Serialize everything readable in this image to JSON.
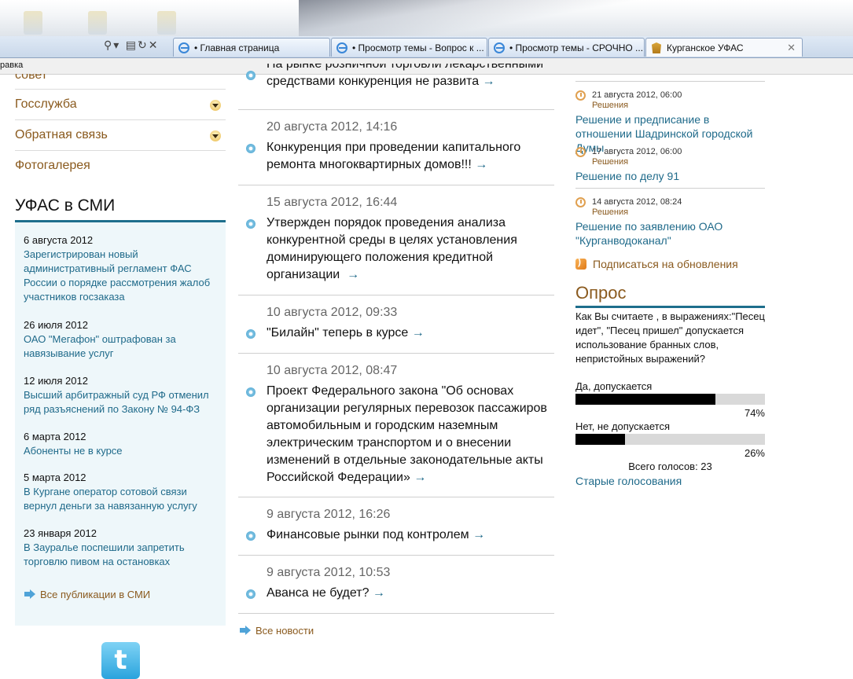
{
  "browser": {
    "toolbar_icons": [
      "search-icon",
      "dropdown-icon",
      "compat-icon",
      "refresh-icon",
      "close-icon"
    ],
    "tabs": [
      {
        "label": "• Главная страница"
      },
      {
        "label": "• Просмотр темы - Вопрос к ..."
      },
      {
        "label": "• Просмотр темы - СРОЧНО ..."
      },
      {
        "label": "Курганское УФАС"
      }
    ],
    "menu_fragment": "равка"
  },
  "left_nav": {
    "partial_top": "совет",
    "items": [
      {
        "label": "Госслужба",
        "has_dropdown": true
      },
      {
        "label": "Обратная связь",
        "has_dropdown": true
      },
      {
        "label": "Фотогалерея",
        "has_dropdown": false
      }
    ]
  },
  "media": {
    "title": "УФАС в СМИ",
    "entries": [
      {
        "date": "6 августа 2012",
        "text": "Зарегистрирован новый административный регламент ФАС России о порядке рассмотрения жалоб участников госзаказа"
      },
      {
        "date": "26 июля 2012",
        "text": "ОАО \"Мегафон\" оштрафован за навязывание услуг"
      },
      {
        "date": "12 июля 2012",
        "text": "Высший арбитражный суд РФ отменил ряд разъяснений по Закону № 94-ФЗ"
      },
      {
        "date": "6 марта 2012",
        "text": "Абоненты не в курсе"
      },
      {
        "date": "5 марта 2012",
        "text": "В Кургане оператор сотовой связи вернул деньги за навязанную услугу"
      },
      {
        "date": "23 января 2012",
        "text": "В Зауралье поспешили запретить торговлю пивом на остановках"
      }
    ],
    "all_link": "Все публикации в СМИ"
  },
  "social": {
    "twitter_glyph": "t"
  },
  "news": {
    "arrow": "→",
    "items": [
      {
        "date": "",
        "text": "На рынке розничной торговли лекарственными средствами конкуренция не развита"
      },
      {
        "date": "20 августа 2012, 14:16",
        "text": "Конкуренция при проведении капитального ремонта многоквартирных домов!!!"
      },
      {
        "date": "15 августа 2012, 16:44",
        "text": "Утвержден порядок проведения анализа конкурентной среды в целях установления доминирующего положения кредитной организации"
      },
      {
        "date": "10 августа 2012, 09:33",
        "text": "\"Билайн\" теперь в курсе"
      },
      {
        "date": "10 августа 2012, 08:47",
        "text": "Проект Федерального закона \"Об основах организации регулярных перевозок пассажиров автомобильным и городским наземным электрическим транспортом и о внесении изменений в отдельные законодательные акты Российской Федерации»"
      },
      {
        "date": "9 августа 2012, 16:26",
        "text": "Финансовые рынки под контролем"
      },
      {
        "date": "9 августа 2012, 10:53",
        "text": "Аванса не будет?"
      }
    ],
    "all_link": "Все новости"
  },
  "documents": [
    {
      "date": "21 августа 2012, 06:00",
      "kind": "Решения",
      "title": "Решение и предписание в отношении Шадринской городской Думы"
    },
    {
      "date": "17 августа 2012, 06:00",
      "kind": "Решения",
      "title": "Решение по делу 91"
    },
    {
      "date": "14 августа 2012, 08:24",
      "kind": "Решения",
      "title": "Решение по заявлению ОАО \"Курганводоканал\""
    }
  ],
  "subscribe": "Подписаться на обновления",
  "poll": {
    "title": "Опрос",
    "question": "Как Вы считаете , в выражениях:\"Песец идет\", \"Песец пришел\" допускается использование бранных слов, непристойных выражений?",
    "options": [
      {
        "label": "Да, допускается",
        "percent_label": "74%",
        "fraction": 0.74
      },
      {
        "label": "Нет, не допускается",
        "percent_label": "26%",
        "fraction": 0.26
      }
    ],
    "total": "Всего голосов: 23",
    "archive_link": "Старые голосования"
  },
  "colors": {
    "accent": "#1e6e8c",
    "link": "#1f6a8a",
    "brown": "#8a5a1e",
    "media_bg": "#eef7fa"
  }
}
